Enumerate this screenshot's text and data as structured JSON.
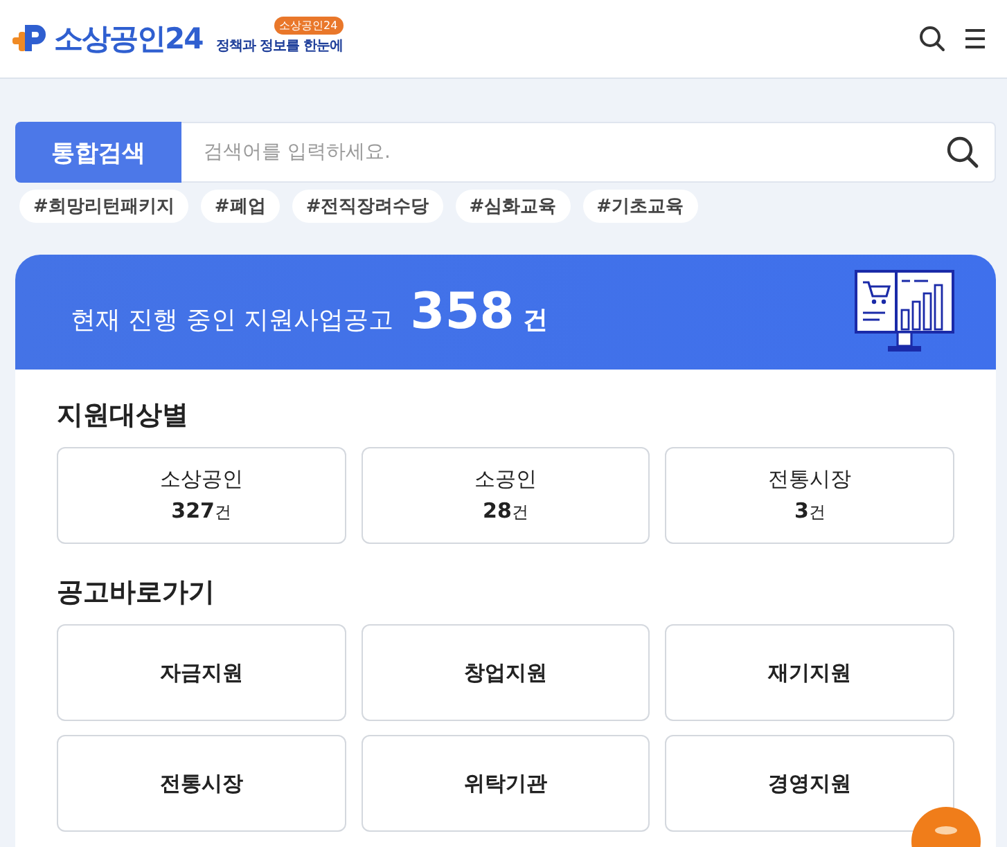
{
  "header": {
    "logo_text": "소상공인24",
    "badge": "소상공인24",
    "tagline": "정책과 정보를 한눈에"
  },
  "search": {
    "label": "통합검색",
    "placeholder": "검색어를 입력하세요."
  },
  "tags": [
    "#희망리턴패키지",
    "#폐업",
    "#전직장려수당",
    "#심화교육",
    "#기초교육"
  ],
  "banner": {
    "text": "현재 진행 중인 지원사업공고",
    "count": "358",
    "unit": "건"
  },
  "sections": [
    {
      "title": "지원대상별",
      "kind": "count",
      "items": [
        {
          "label": "소상공인",
          "count": "327",
          "unit": "건"
        },
        {
          "label": "소공인",
          "count": "28",
          "unit": "건"
        },
        {
          "label": "전통시장",
          "count": "3",
          "unit": "건"
        }
      ]
    },
    {
      "title": "공고바로가기",
      "kind": "link",
      "items": [
        {
          "label": "자금지원"
        },
        {
          "label": "창업지원"
        },
        {
          "label": "재기지원"
        },
        {
          "label": "전통시장"
        },
        {
          "label": "위탁기관"
        },
        {
          "label": "경영지원"
        }
      ]
    }
  ]
}
